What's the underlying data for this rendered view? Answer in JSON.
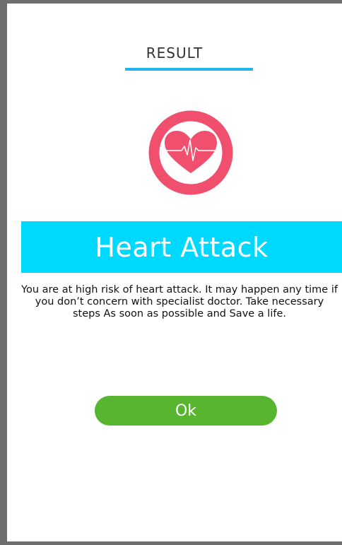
{
  "header": {
    "title": "RESULT"
  },
  "icon": {
    "name": "heart-pulse-icon",
    "ring_color": "#f0506e",
    "heart_color": "#f0506e"
  },
  "result": {
    "title": "Heart Attack",
    "message": "You are at high risk of heart attack. It may happen any time if you don’t concern with specialist doctor. Take necessary steps As soon as possible and Save a life."
  },
  "actions": {
    "ok_label": "Ok"
  },
  "colors": {
    "accent": "#1fb6ef",
    "banner": "#00d9ff",
    "button": "#58b530",
    "frame": "#6f6f6f"
  }
}
